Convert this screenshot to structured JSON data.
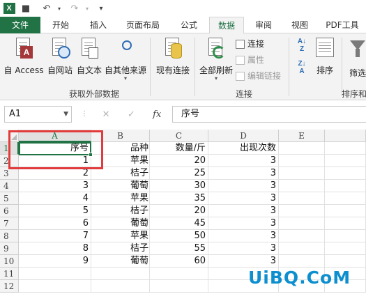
{
  "app": {
    "name": "Excel"
  },
  "tabs": [
    "文件",
    "开始",
    "插入",
    "页面布局",
    "公式",
    "数据",
    "审阅",
    "视图",
    "PDF工具"
  ],
  "active_tab_index": 5,
  "ribbon": {
    "external_data": {
      "label": "获取外部数据",
      "buttons": [
        "自 Access",
        "自网站",
        "自文本",
        "自其他来源"
      ]
    },
    "existing_connections": "现有连接",
    "connections": {
      "label": "连接",
      "refresh_all": "全部刷新",
      "connection": "连接",
      "properties": "属性",
      "edit_links": "编辑链接"
    },
    "sort_filter": {
      "label": "排序和",
      "sort_az_top": "A",
      "sort_az_bottom": "Z",
      "sort_za_top": "Z",
      "sort_za_bottom": "A",
      "sort": "排序",
      "filter": "筛选"
    }
  },
  "formula_bar": {
    "name_box": "A1",
    "fx": "fx",
    "formula": "序号"
  },
  "sheet": {
    "columns": [
      "A",
      "B",
      "C",
      "D",
      "E"
    ],
    "rows": [
      [
        "序号",
        "品种",
        "数量/斤",
        "出现次数"
      ],
      [
        "1",
        "苹果",
        "20",
        "3"
      ],
      [
        "2",
        "桔子",
        "25",
        "3"
      ],
      [
        "3",
        "葡萄",
        "30",
        "3"
      ],
      [
        "4",
        "苹果",
        "35",
        "3"
      ],
      [
        "5",
        "桔子",
        "20",
        "3"
      ],
      [
        "6",
        "葡萄",
        "45",
        "3"
      ],
      [
        "7",
        "苹果",
        "50",
        "3"
      ],
      [
        "8",
        "桔子",
        "55",
        "3"
      ],
      [
        "9",
        "葡萄",
        "60",
        "3"
      ],
      [
        "",
        "",
        "",
        ""
      ],
      [
        "",
        "",
        "",
        ""
      ]
    ],
    "row_numbers": [
      "1",
      "2",
      "3",
      "4",
      "5",
      "6",
      "7",
      "8",
      "9",
      "10",
      "11",
      "12"
    ],
    "selected_cell": "A1",
    "accent_color": "#217346"
  },
  "watermark": "UiBQ.CoM"
}
